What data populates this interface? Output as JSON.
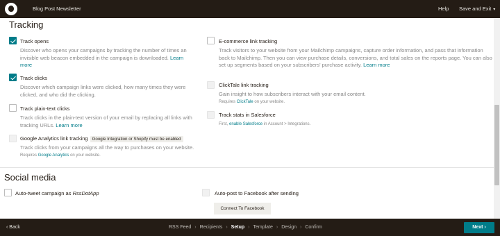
{
  "topbar": {
    "campaign_title": "Blog Post Newsletter",
    "help": "Help",
    "save_exit": "Save and Exit",
    "save_caret": "▾"
  },
  "tracking": {
    "heading": "Tracking",
    "options": [
      {
        "label": "Track opens",
        "checked": true,
        "desc": "Discover who opens your campaigns by tracking the number of times an invisible web beacon embedded in the campaign is downloaded.",
        "link": "Learn more"
      },
      {
        "label": "Track clicks",
        "checked": true,
        "desc": "Discover which campaign links were clicked, how many times they were clicked, and who did the clicking."
      },
      {
        "label": "Track plain-text clicks",
        "checked": false,
        "desc": "Track clicks in the plain-text version of your email by replacing all links with tracking URLs.",
        "link": "Learn more"
      },
      {
        "label": "Google Analytics link tracking",
        "badge": "Google Integration or Shopify must be enabled",
        "disabled": true,
        "desc": "Track clicks from your campaigns all the way to purchases on your website.",
        "note_prefix": "Requires",
        "note_link": "Google Analytics",
        "note_suffix": "on your website."
      },
      {
        "label": "E-commerce link tracking",
        "checked": false,
        "desc": "Track visitors to your website from your Mailchimp campaigns, capture order information, and pass that information back to Mailchimp. Then you can view purchase details, conversions, and total sales on the reports page. You can also set up segments based on your subscribers' purchase activity.",
        "link": "Learn more"
      },
      {
        "label": "ClickTale link tracking",
        "disabled": true,
        "desc": "Gain insight to how subscribers interact with your email content.",
        "note_prefix": "Requires",
        "note_link": "ClickTale",
        "note_suffix": "on your website."
      },
      {
        "label": "Track stats in Salesforce",
        "disabled": true,
        "note_prefix": "First,",
        "note_link": "enable Salesforce",
        "note_suffix": "in Account > Integrations."
      }
    ]
  },
  "social": {
    "heading": "Social media",
    "auto_tweet_prefix": "Auto-tweet campaign as",
    "auto_tweet_handle": "RssDotApp",
    "auto_post_facebook": "Auto-post to Facebook after sending",
    "connect_facebook": "Connect To Facebook"
  },
  "footer": {
    "back": "‹ Back",
    "steps": [
      "RSS Feed",
      "Recipients",
      "Setup",
      "Template",
      "Design",
      "Confirm"
    ],
    "active_step": "Setup",
    "separator": "›",
    "next": "Next ›"
  },
  "colors": {
    "accent": "#007c89",
    "dark": "#241c15",
    "muted_text": "#878787"
  }
}
